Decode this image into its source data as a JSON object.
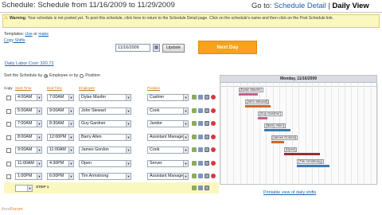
{
  "header": {
    "title": "Schedule: Schedule from 11/16/2009 to 11/29/2009",
    "goto_prefix": "Go to:",
    "goto_link": "Schedule Detail",
    "goto_sep": "|",
    "goto_current": "Daily View"
  },
  "warning": {
    "label": "Warning:",
    "text": "Your schedule is not posted yet. To post this schedule, click here to return to the Schedule Detail page. Click on the schedule's name and then click on the Post Schedule link."
  },
  "templates": {
    "prefix": "Templates:",
    "use": "Use",
    "or": "or",
    "make": "make",
    "copy": "Copy Shifts"
  },
  "date": {
    "value": "11/16/2009",
    "update": "Update",
    "next_day": "Next Day",
    "calendar_icon": "calendar-icon"
  },
  "labor_cost": "Daily Labor Cost: 320.72",
  "sort": {
    "label": "Sort the Schedule by",
    "employee": "Employee or by",
    "position": "Position"
  },
  "columns": {
    "copy": "Copy",
    "start": "Start Time",
    "end": "End Time",
    "employee": "Employee",
    "position": "Position"
  },
  "shifts": [
    {
      "start": "4:00AM",
      "end": "7:00AM",
      "employee": "Dylan Maxfer",
      "position": "Cashier"
    },
    {
      "start": "5:00AM",
      "end": "9:00AM",
      "employee": "John Stewart",
      "position": "Cook"
    },
    {
      "start": "7:00AM",
      "end": "8:30AM",
      "employee": "Guy Gardner",
      "position": "Janitor"
    },
    {
      "start": "8:00AM",
      "end": "12:00PM",
      "employee": "Barry Allen",
      "position": "Assistant Manage"
    },
    {
      "start": "9:00AM",
      "end": "11:00AM",
      "employee": "James Gordon",
      "position": "Cook"
    },
    {
      "start": "11:00AM",
      "end": "4:30PM",
      "employee": "Open",
      "position": "Server"
    },
    {
      "start": "1:00PM",
      "end": "6:00PM",
      "employee": "Tim Armstrong",
      "position": "Assistant Manage"
    }
  ],
  "step": "STEP 1",
  "gantt": {
    "date": "Monday, 11/16/2009",
    "bars": [
      {
        "label": "[Dylan Maxfer]",
        "start": 4,
        "end": 7,
        "color": "#c0628c"
      },
      {
        "label": "[John Stewart]",
        "start": 5,
        "end": 9,
        "color": "#c96a2e"
      },
      {
        "label": "[Guy Gardner]",
        "start": 7,
        "end": 8.5,
        "color": "#c0628c"
      },
      {
        "label": "[Barry Allen]",
        "start": 8,
        "end": 12,
        "color": "#3f79ad"
      },
      {
        "label": "[James Gordon]",
        "start": 9,
        "end": 11,
        "color": "#c96a2e"
      },
      {
        "label": "[Open]",
        "start": 11,
        "end": 16.5,
        "color": "#9a2f2f"
      },
      {
        "label": "[Tim Armstrong]",
        "start": 13,
        "end": 18,
        "color": "#3f79ad"
      }
    ]
  },
  "print_link": "Printable view of daily shifts",
  "footer": {
    "a": "i",
    "b": "free",
    "c": "Forum"
  }
}
